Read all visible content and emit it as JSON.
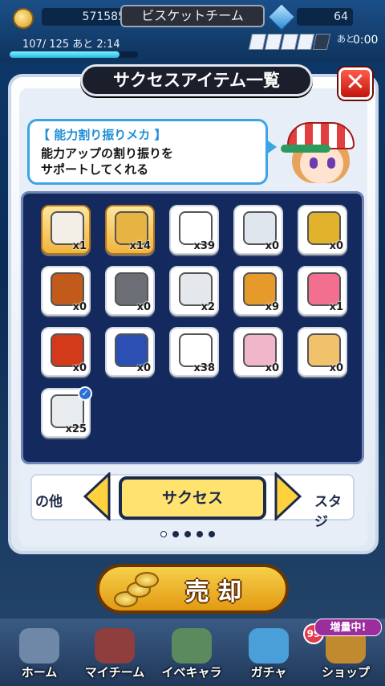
{
  "status_bar": {
    "points": "571585",
    "team_name": "ビスケットチーム",
    "gems": "64",
    "stamina_text": "107/ 125 あと 2:14",
    "stamina_fraction": 0.856,
    "tickets_label": "あと",
    "tickets_time": "0:00"
  },
  "dialog": {
    "title": "サクセスアイテム一覧",
    "close_label": "✕",
    "speech_title": "【 能力割り振りメカ 】",
    "speech_text": "能力アップの割り振りを\nサポートしてくれる"
  },
  "items": [
    {
      "icon": "paper-document-icon",
      "count": "x1",
      "gold": true
    },
    {
      "icon": "success-charm-icon",
      "count": "x14",
      "gold": true
    },
    {
      "icon": "lucky-charm-tag-icon",
      "count": "x39",
      "gold": false
    },
    {
      "icon": "sword-blade-icon",
      "count": "x0",
      "gold": false
    },
    {
      "icon": "energy-drink-bottle-icon",
      "count": "x0",
      "gold": false
    },
    {
      "icon": "sauce-bottle-icon",
      "count": "x0",
      "gold": false
    },
    {
      "icon": "pipe-icon",
      "count": "x0",
      "gold": false
    },
    {
      "icon": "aroma-candle-icon",
      "count": "x2",
      "gold": false
    },
    {
      "icon": "dog-food-bowl-icon",
      "count": "x9",
      "gold": false
    },
    {
      "icon": "heart-charm-icon",
      "count": "x1",
      "gold": false
    },
    {
      "icon": "stamp-hanko-icon",
      "count": "x0",
      "gold": false
    },
    {
      "icon": "spray-can-icon",
      "count": "x0",
      "gold": false
    },
    {
      "icon": "lucky-cat-icon",
      "count": "x38",
      "gold": false
    },
    {
      "icon": "gift-box-icon",
      "count": "x0",
      "gold": false
    },
    {
      "icon": "pawa-snack-bar-icon",
      "count": "x0",
      "gold": false
    },
    {
      "icon": "robot-mecha-icon",
      "count": "x25",
      "gold": false,
      "checked": true
    }
  ],
  "tabs": {
    "left": "の他",
    "current": "サクセス",
    "right": "スタジ",
    "page_count": 5,
    "active_page": 1
  },
  "sell_button": {
    "label": "売 却"
  },
  "bottom_nav": [
    {
      "label": "ホーム"
    },
    {
      "label": "マイチーム"
    },
    {
      "label": "イベキャラ"
    },
    {
      "label": "ガチャ"
    },
    {
      "label": "ショップ"
    }
  ],
  "gacha_badge": "99",
  "shop_promo": "増量中!",
  "colors": {
    "dialog_border": "#c9d7ea",
    "speech_blue": "#3aa5e6",
    "grid_navy": "#142a5e",
    "tab_yellow": "#ffe36e",
    "close_red": "#d8261a",
    "sell_gold": "#f0b52c"
  }
}
